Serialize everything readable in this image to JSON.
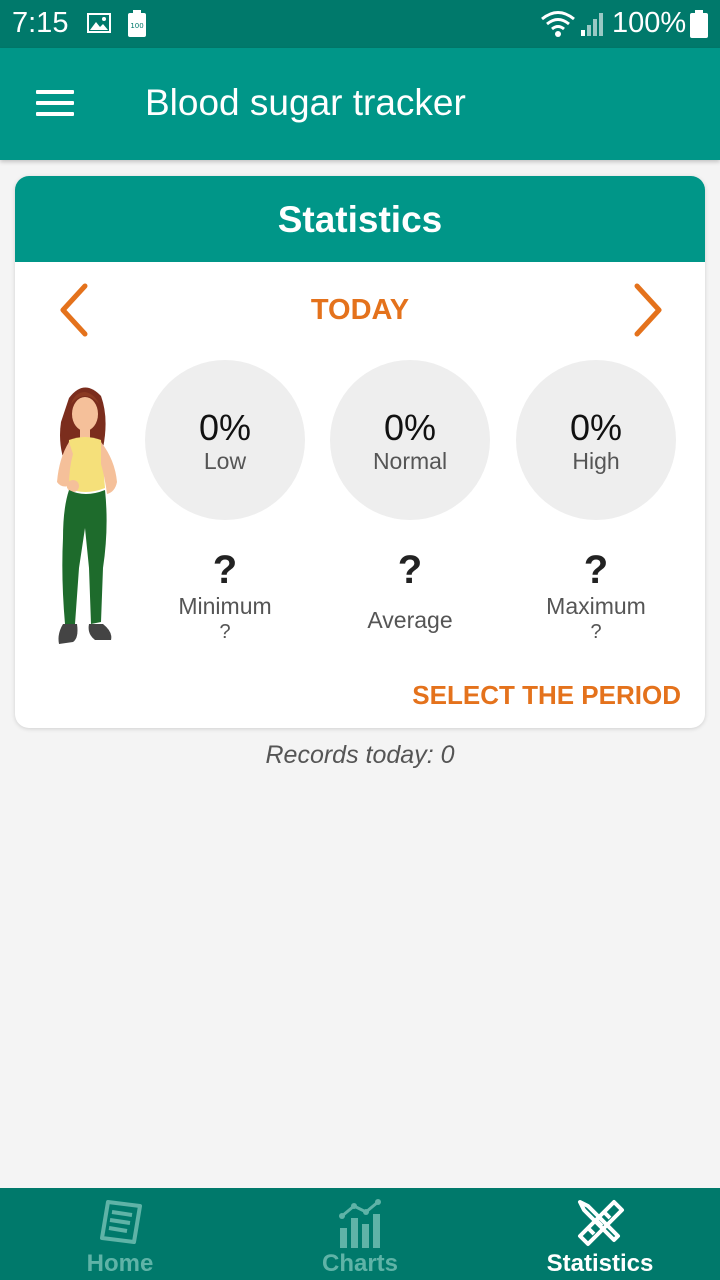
{
  "status_bar": {
    "time": "7:15",
    "battery_pct": "100%",
    "small_battery_label": "100"
  },
  "app_bar": {
    "title": "Blood sugar tracker"
  },
  "card": {
    "header": "Statistics",
    "period_label": "TODAY",
    "ranges": [
      {
        "percent": "0%",
        "label": "Low"
      },
      {
        "percent": "0%",
        "label": "Normal"
      },
      {
        "percent": "0%",
        "label": "High"
      }
    ],
    "stats": {
      "minimum": {
        "value": "?",
        "label": "Minimum",
        "sub": "?"
      },
      "average": {
        "value": "?",
        "label": "Average"
      },
      "maximum": {
        "value": "?",
        "label": "Maximum",
        "sub": "?"
      }
    },
    "select_period": "SELECT THE PERIOD"
  },
  "records": "Records today: 0",
  "bottom_nav": {
    "items": [
      {
        "label": "Home",
        "icon": "home-list-icon"
      },
      {
        "label": "Charts",
        "icon": "charts-icon"
      },
      {
        "label": "Statistics",
        "icon": "statistics-icon"
      }
    ],
    "active": "Statistics"
  },
  "colors": {
    "primary": "#009688",
    "primary_dark": "#00796b",
    "accent": "#e4721c"
  }
}
